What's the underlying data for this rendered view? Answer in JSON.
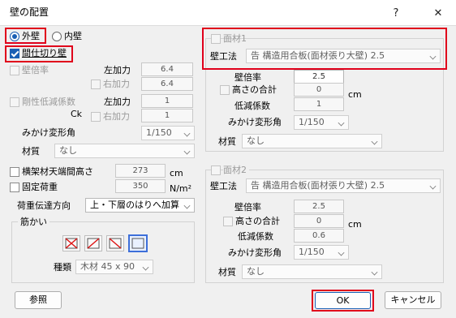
{
  "window": {
    "title": "壁の配置",
    "help_icon": "?",
    "close_icon": "✕"
  },
  "wall_type": {
    "outer": "外壁",
    "inner": "内壁",
    "partition": "間仕切り壁"
  },
  "left": {
    "bai_label": "壁倍率",
    "left_force": "左加力",
    "right_force": "右加力",
    "bai_left_val": "6.4",
    "bai_right_val": "6.4",
    "stiff_label": "剛性低減係数",
    "ck_label": "Ck",
    "stiff_left_val": "1",
    "stiff_right_val": "1",
    "deform_label": "みかけ変形角",
    "deform_value": "1/150",
    "material_label": "材質",
    "material_value": "なし",
    "beam_height_label": "横架材天端間高さ",
    "beam_height_value": "273",
    "beam_height_unit": "cm",
    "fixed_load_label": "固定荷重",
    "fixed_load_value": "350",
    "fixed_load_unit": "N/m²",
    "load_dir_label": "荷重伝達方向",
    "load_dir_value": "上・下層のはりへ加算",
    "brace_group": "筋かい",
    "brace_type_label": "種類",
    "brace_type_value": "木材 45 x 90"
  },
  "surface1": {
    "title": "面材1",
    "method_label": "壁工法",
    "method_value": "告 構造用合板(面材張り大壁) 2.5",
    "bai_label": "壁倍率",
    "bai_value": "2.5",
    "height_total_label": "高さの合計",
    "height_total_value": "0",
    "height_unit": "cm",
    "reduce_label": "低減係数",
    "reduce_value": "1",
    "deform_label": "みかけ変形角",
    "deform_value": "1/150",
    "material_label": "材質",
    "material_value": "なし"
  },
  "surface2": {
    "title": "面材2",
    "method_label": "壁工法",
    "method_value": "告 構造用合板(面材張り大壁) 2.5",
    "bai_label": "壁倍率",
    "bai_value": "2.5",
    "height_total_label": "高さの合計",
    "height_total_value": "0",
    "height_unit": "cm",
    "reduce_label": "低減係数",
    "reduce_value": "0.6",
    "deform_label": "みかけ変形角",
    "deform_value": "1/150",
    "material_label": "材質",
    "material_value": "なし"
  },
  "buttons": {
    "reference": "参照",
    "ok": "OK",
    "cancel": "キャンセル"
  },
  "colors": {
    "highlight": "#e0001b",
    "accent": "#1a5fb4"
  }
}
